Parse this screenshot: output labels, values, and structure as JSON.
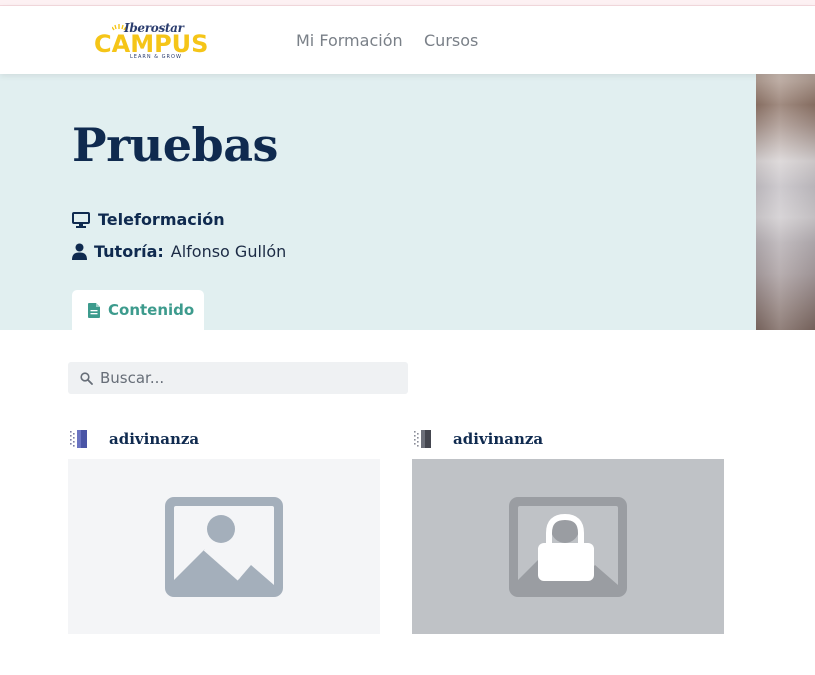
{
  "header": {
    "logo": {
      "top_text": "Iberostar",
      "main_text": "CAMPUS",
      "sub_text": "LEARN & GROW"
    },
    "nav": [
      {
        "label": "Mi Formación"
      },
      {
        "label": "Cursos"
      }
    ]
  },
  "course": {
    "title": "Pruebas",
    "modality": "Teleformación",
    "tutor_label": "Tutoría:",
    "tutor_name": "Alfonso Gullón",
    "tab_label": "Contenido"
  },
  "search": {
    "placeholder": "Buscar..."
  },
  "items": [
    {
      "name": "adivinanza",
      "locked": false,
      "icon": "interactive-module-icon"
    },
    {
      "name": "adivinanza",
      "locked": true,
      "icon": "interactive-module-icon"
    }
  ],
  "colors": {
    "accent": "#3d9b8d",
    "title": "#0f2a4f",
    "hero_bg": "#e1eff0",
    "logo_yellow": "#f5c518"
  }
}
